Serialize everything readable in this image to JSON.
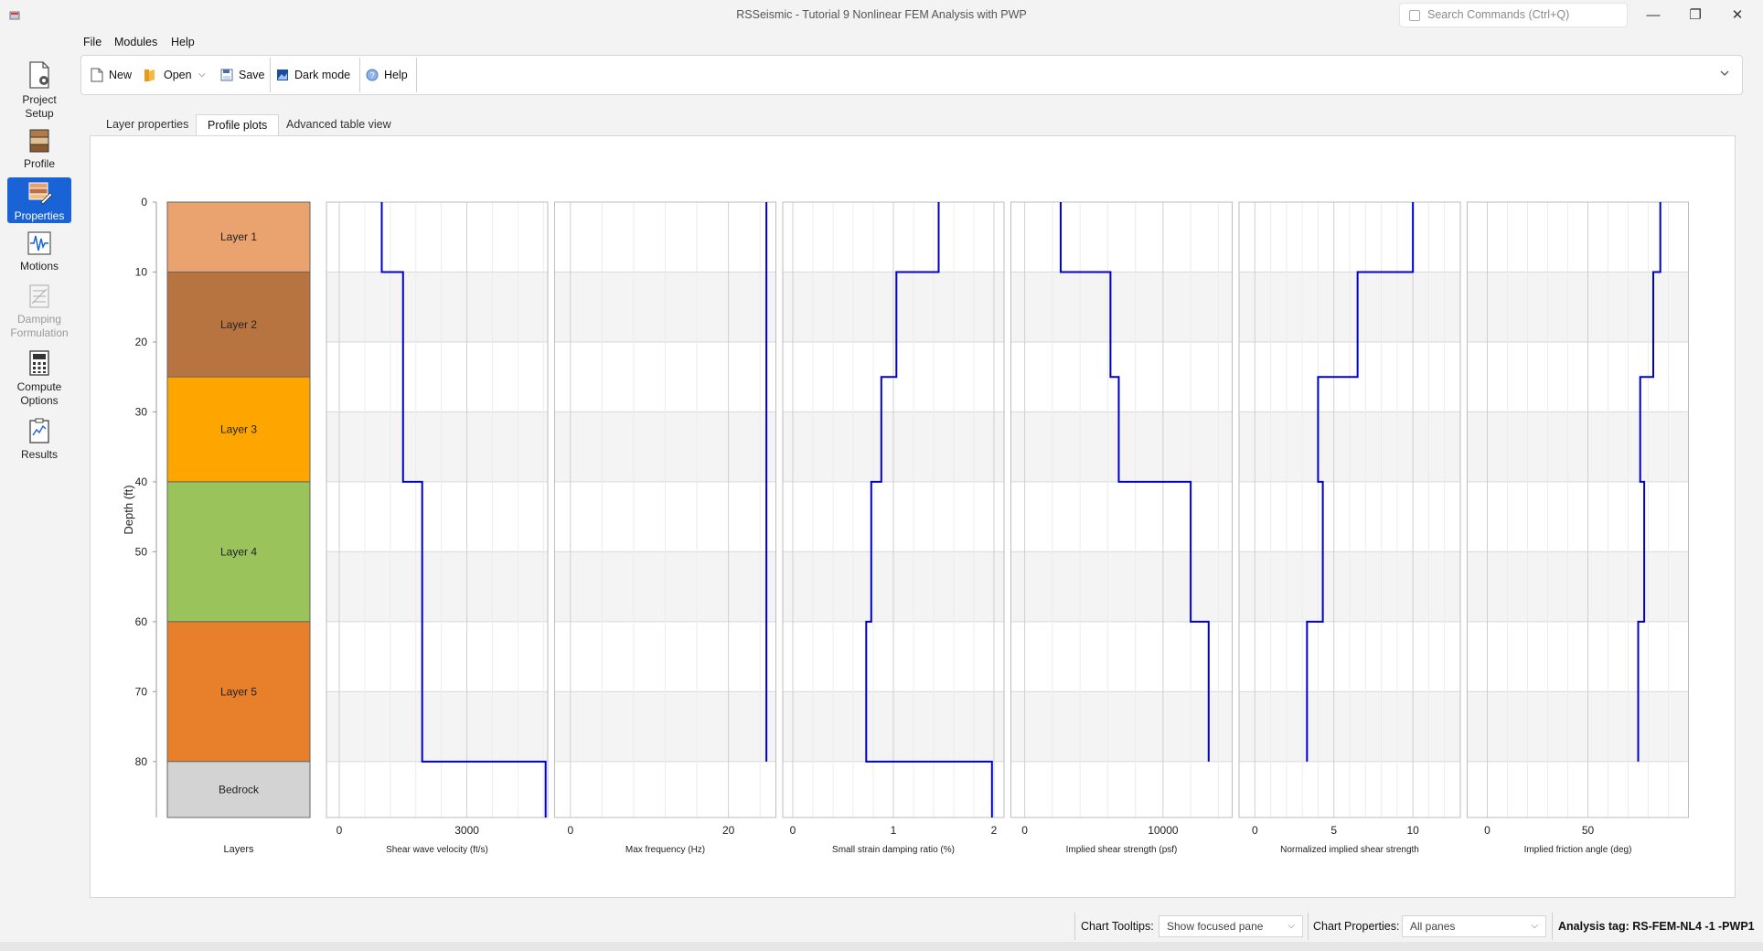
{
  "window": {
    "title": "RSSeismic - Tutorial 9 Nonlinear FEM Analysis with PWP",
    "search_placeholder": "Search Commands (Ctrl+Q)",
    "minimize": "—",
    "maximize": "❐",
    "close": "✕"
  },
  "sidebar": {
    "items": [
      {
        "label1": "Project",
        "label2": "Setup",
        "icon": "project-setup-icon"
      },
      {
        "label1": "Profile",
        "label2": "",
        "icon": "profile-icon"
      },
      {
        "label1": "Properties",
        "label2": "",
        "icon": "properties-icon"
      },
      {
        "label1": "Motions",
        "label2": "",
        "icon": "motions-icon"
      },
      {
        "label1": "Damping",
        "label2": "Formulation",
        "icon": "damping-icon"
      },
      {
        "label1": "Compute",
        "label2": "Options",
        "icon": "compute-icon"
      },
      {
        "label1": "Results",
        "label2": "",
        "icon": "results-icon"
      }
    ]
  },
  "menu": {
    "file": "File",
    "modules": "Modules",
    "help": "Help"
  },
  "toolbar": {
    "new": "New",
    "open": "Open",
    "save": "Save",
    "dark_mode": "Dark mode",
    "help": "Help"
  },
  "tabs": [
    "Layer properties",
    "Profile plots",
    "Advanced table view"
  ],
  "status": {
    "tooltips_label": "Chart Tooltips:",
    "tooltips_value": "Show focused pane",
    "properties_label": "Chart Properties:",
    "properties_value": "All panes",
    "analysis_tag": "Analysis tag: RS-FEM-NL4 -1 -PWP1"
  },
  "colors": {
    "accent": "#1a63d6",
    "line": "#0000cc"
  },
  "chart_data": {
    "type": "line",
    "ylabel": "Depth (ft)",
    "y_ticks": [
      0,
      10,
      20,
      30,
      40,
      50,
      60,
      70,
      80
    ],
    "ylim": [
      0,
      88
    ],
    "grid": true,
    "layers": {
      "xlabel": "Layers",
      "items": [
        {
          "name": "Layer 1",
          "top": 0,
          "bottom": 10,
          "color": "#eaa36e"
        },
        {
          "name": "Layer 2",
          "top": 10,
          "bottom": 25,
          "color": "#b87440"
        },
        {
          "name": "Layer 3",
          "top": 25,
          "bottom": 40,
          "color": "#ffa500"
        },
        {
          "name": "Layer 4",
          "top": 40,
          "bottom": 60,
          "color": "#9bc35c"
        },
        {
          "name": "Layer 5",
          "top": 60,
          "bottom": 80,
          "color": "#e87f2a"
        },
        {
          "name": "Bedrock",
          "top": 80,
          "bottom": 88,
          "color": "#d3d3d3"
        }
      ]
    },
    "panes": [
      {
        "xlabel": "Shear wave velocity (ft/s)",
        "xlim": [
          -300,
          4900
        ],
        "ticks": [
          0,
          3000
        ],
        "profile": [
          {
            "top": 0,
            "bottom": 10,
            "value": 1000
          },
          {
            "top": 10,
            "bottom": 40,
            "value": 1500
          },
          {
            "top": 40,
            "bottom": 80,
            "value": 1950
          },
          {
            "top": 80,
            "bottom": 88,
            "value": 4850
          }
        ]
      },
      {
        "xlabel": "Max frequency (Hz)",
        "xlim": [
          -2,
          26
        ],
        "ticks": [
          0,
          20
        ],
        "profile": [
          {
            "top": 0,
            "bottom": 80,
            "value": 24.8
          }
        ]
      },
      {
        "xlabel": "Small strain damping ratio (%)",
        "xlim": [
          -0.1,
          2.1
        ],
        "ticks": [
          0,
          1,
          2
        ],
        "profile": [
          {
            "top": 0,
            "bottom": 10,
            "value": 1.45
          },
          {
            "top": 10,
            "bottom": 25,
            "value": 1.03
          },
          {
            "top": 25,
            "bottom": 40,
            "value": 0.88
          },
          {
            "top": 40,
            "bottom": 60,
            "value": 0.78
          },
          {
            "top": 60,
            "bottom": 80,
            "value": 0.73
          },
          {
            "top": 80,
            "bottom": 88,
            "value": 1.98
          }
        ]
      },
      {
        "xlabel": "Implied shear strength (psf)",
        "xlim": [
          -1000,
          15000
        ],
        "ticks": [
          0,
          10000
        ],
        "profile": [
          {
            "top": 0,
            "bottom": 10,
            "value": 2600
          },
          {
            "top": 10,
            "bottom": 25,
            "value": 6200
          },
          {
            "top": 25,
            "bottom": 40,
            "value": 6800
          },
          {
            "top": 40,
            "bottom": 60,
            "value": 12000
          },
          {
            "top": 60,
            "bottom": 80,
            "value": 13300
          }
        ]
      },
      {
        "xlabel": "Normalized implied shear strength",
        "xlim": [
          -1,
          13
        ],
        "ticks": [
          0,
          5,
          10
        ],
        "profile": [
          {
            "top": 0,
            "bottom": 10,
            "value": 10
          },
          {
            "top": 10,
            "bottom": 25,
            "value": 6.5
          },
          {
            "top": 25,
            "bottom": 40,
            "value": 4
          },
          {
            "top": 40,
            "bottom": 60,
            "value": 4.3
          },
          {
            "top": 60,
            "bottom": 80,
            "value": 3.3
          }
        ]
      },
      {
        "xlabel": "Implied friction angle (deg)",
        "xlim": [
          -10,
          100
        ],
        "ticks": [
          0,
          50
        ],
        "profile": [
          {
            "top": 0,
            "bottom": 10,
            "value": 86
          },
          {
            "top": 10,
            "bottom": 25,
            "value": 82.5
          },
          {
            "top": 25,
            "bottom": 40,
            "value": 76
          },
          {
            "top": 40,
            "bottom": 60,
            "value": 78
          },
          {
            "top": 60,
            "bottom": 80,
            "value": 75
          }
        ]
      }
    ]
  }
}
